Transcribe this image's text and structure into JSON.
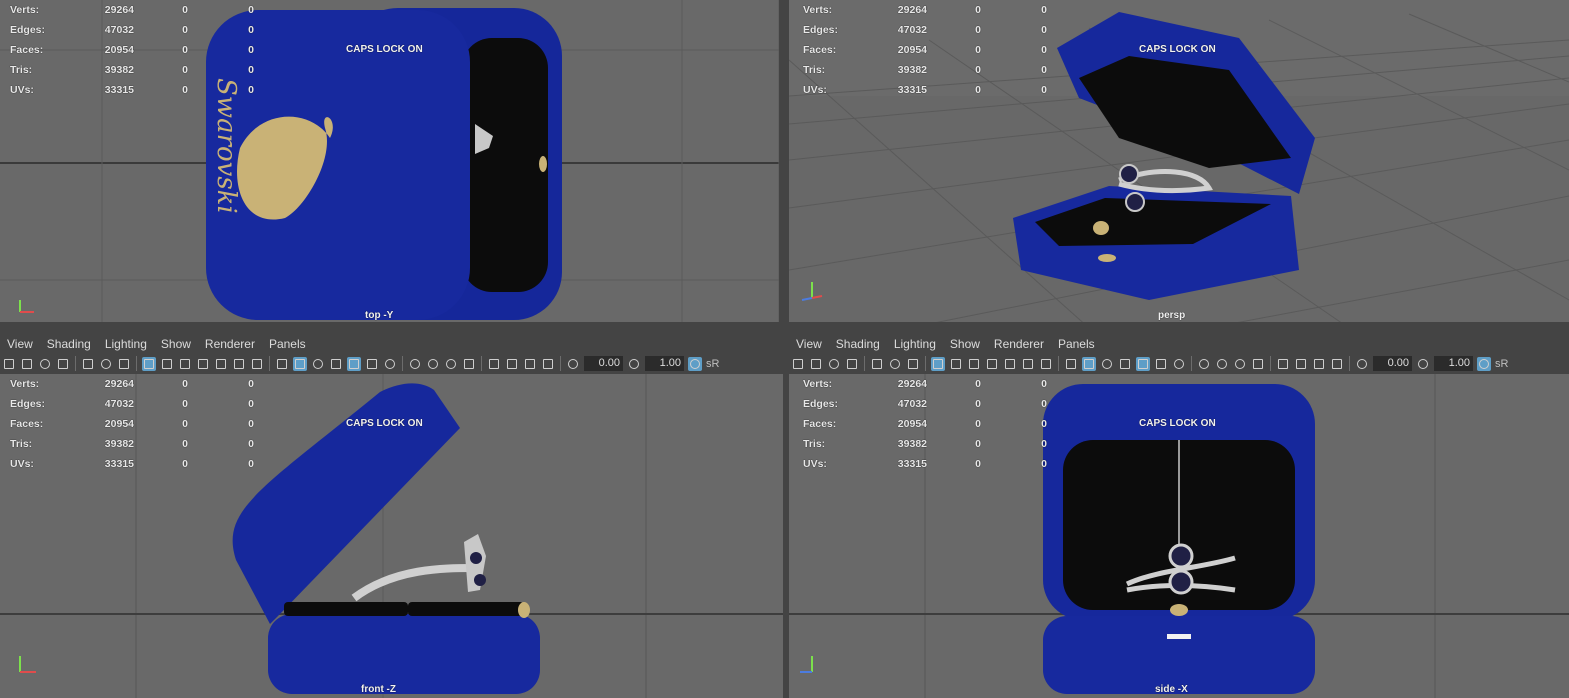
{
  "stats": {
    "rows": [
      {
        "label": "Verts:",
        "v1": "29264",
        "v2": "0",
        "v3": "0"
      },
      {
        "label": "Edges:",
        "v1": "47032",
        "v2": "0",
        "v3": "0"
      },
      {
        "label": "Faces:",
        "v1": "20954",
        "v2": "0",
        "v3": "0"
      },
      {
        "label": "Tris:",
        "v1": "39382",
        "v2": "0",
        "v3": "0"
      },
      {
        "label": "UVs:",
        "v1": "33315",
        "v2": "0",
        "v3": "0"
      }
    ]
  },
  "caps_lock": "CAPS LOCK ON",
  "viewports": {
    "top": {
      "label": "top -Y"
    },
    "persp": {
      "label": "persp"
    },
    "front": {
      "label": "front -Z"
    },
    "side": {
      "label": "side -X"
    }
  },
  "menu": [
    "View",
    "Shading",
    "Lighting",
    "Show",
    "Renderer",
    "Panels"
  ],
  "toolbar": {
    "exposure": "0.00",
    "gamma": "1.00",
    "colorspace": "sR"
  },
  "box": {
    "brand": "Swarovski",
    "velvet_color": "#15279a",
    "interior_color": "#0c0c0c",
    "logo_color": "#c9b276",
    "axis_y_color": "#7ce04c",
    "axis_x_color": "#e04c4c",
    "axis_z_color": "#4c7ce0"
  }
}
